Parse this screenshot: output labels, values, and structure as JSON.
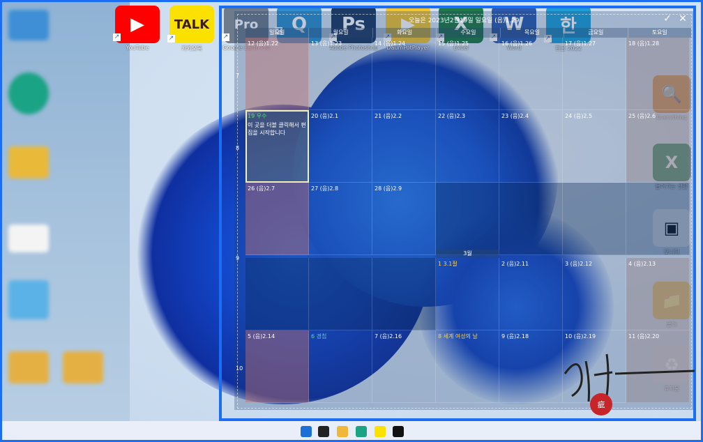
{
  "desktop": {
    "top_icons": [
      {
        "name": "youtube",
        "label": "YouTube",
        "glyph": "▶",
        "color": "#ff0000"
      },
      {
        "name": "kakaotalk",
        "label": "카카오톡",
        "glyph": "TALK",
        "color": "#fae100"
      },
      {
        "name": "google-earth-pro",
        "label": "Google Earth Pro",
        "glyph": "Pro",
        "color": "#6d7b8a"
      },
      {
        "name": "app-q",
        "label": "",
        "glyph": "Q",
        "color": "#2d8fcf"
      },
      {
        "name": "photoshop",
        "label": "Adobe Photoshop CS6 (64 Bit)",
        "glyph": "Ps",
        "color": "#1b3a63"
      },
      {
        "name": "daum-potplayer",
        "label": "DaumPotPlayer",
        "glyph": "▶",
        "color": "#f2c430"
      },
      {
        "name": "excel",
        "label": "Excel",
        "glyph": "X",
        "color": "#1d7a45"
      },
      {
        "name": "word",
        "label": "Word",
        "glyph": "W",
        "color": "#2b5ab0"
      },
      {
        "name": "hangul",
        "label": "한글 2022",
        "glyph": "한",
        "color": "#1c9fd8"
      }
    ],
    "right_icons": [
      {
        "name": "everything",
        "label": "Everything",
        "glyph": "🔍"
      },
      {
        "name": "excel-file",
        "label": "들어가는 생활",
        "glyph": "X"
      },
      {
        "name": "monitor",
        "label": "모니터",
        "glyph": "▣"
      },
      {
        "name": "folder",
        "label": "폴더",
        "glyph": "📁"
      },
      {
        "name": "recycle-bin",
        "label": "휴지통",
        "glyph": "♻"
      }
    ]
  },
  "calendar": {
    "title": "오늘은 2023년2월19일 일요일 (음)1.29",
    "check_icon": "✓",
    "close_icon": "✕",
    "weekdays": [
      "일요일",
      "월요일",
      "화요일",
      "수요일",
      "목요일",
      "금요일",
      "토요일"
    ],
    "weeks": [
      {
        "num": "7",
        "days": [
          "12 (음)1.22",
          "13 (음)1.23",
          "14 (음)1.24",
          "15 (음)1.25",
          "16 (음)1.26",
          "17 (음)1.27",
          "18 (음)1.28"
        ]
      },
      {
        "num": "8",
        "days": [
          "19 우수",
          "20 (음)2.1",
          "21 (음)2.2",
          "22 (음)2.3",
          "23 (음)2.4",
          "24 (음)2.5",
          "25 (음)2.6"
        ]
      },
      {
        "num": "",
        "days": [
          "26 (음)2.7",
          "27 (음)2.8",
          "28 (음)2.9",
          "",
          "",
          "",
          ""
        ]
      },
      {
        "num": "9",
        "days": [
          "",
          "",
          "",
          "1 3.1절",
          "2 (음)2.11",
          "3 (음)2.12",
          "4 (음)2.13"
        ]
      },
      {
        "num": "10",
        "days": [
          "5 (음)2.14",
          "6 경칩",
          "7 (음)2.16",
          "8 세계 여성의 날",
          "9 (음)2.18",
          "10 (음)2.19",
          "11 (음)2.20"
        ]
      }
    ],
    "today_note": "이 곳을 더블 클릭해서 편집을 시작합니다",
    "month_label": "3월"
  },
  "colors": {
    "frame_border": "#1b6ef3",
    "holiday_green": "#53e07a",
    "event_yellow": "#ffd24a"
  }
}
